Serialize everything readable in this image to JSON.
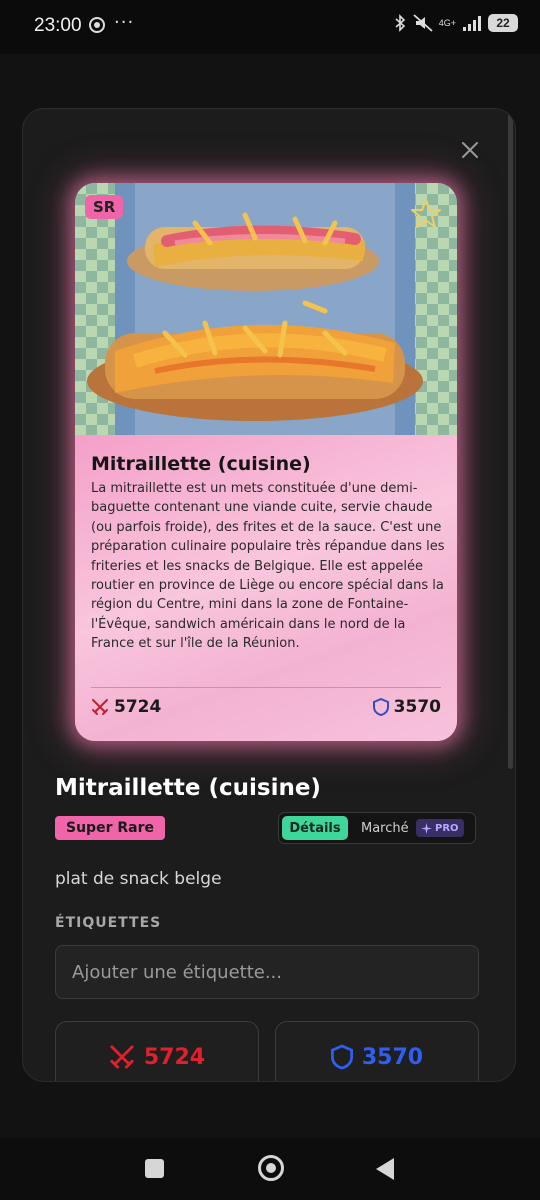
{
  "status_bar": {
    "time": "23:00",
    "more": "···",
    "network": "4G+",
    "battery": "22"
  },
  "card": {
    "rarity_badge": "SR",
    "title": "Mitraillette (cuisine)",
    "description": "La mitraillette est un mets constituée d'une demi-baguette contenant une viande cuite, servie chaude (ou parfois froide), des frites et de la sauce. C'est une préparation culinaire populaire très répandue dans les friteries et les snacks de Belgique. Elle est appelée routier en province de Liège ou encore spécial dans la région du Centre, mini dans la zone de Fontaine-l'Évêque, sandwich américain dans le nord de la France et sur l'île de la Réunion.",
    "attack": "5724",
    "defense": "3570",
    "glow_color": "#f078aa"
  },
  "detail": {
    "title": "Mitraillette (cuisine)",
    "rarity": "Super Rare",
    "subtitle": "plat de snack belge",
    "tags_label": "ÉTIQUETTES",
    "tag_placeholder": "Ajouter une étiquette...",
    "attack": "5724",
    "defense": "3570"
  },
  "tabs": {
    "details": "Détails",
    "market": "Marché",
    "pro": "PRO"
  },
  "colors": {
    "rarity_pink": "#f064aa",
    "tab_active": "#3ed69b",
    "attack_red": "#e0202c",
    "defense_blue": "#2f5ff0"
  }
}
